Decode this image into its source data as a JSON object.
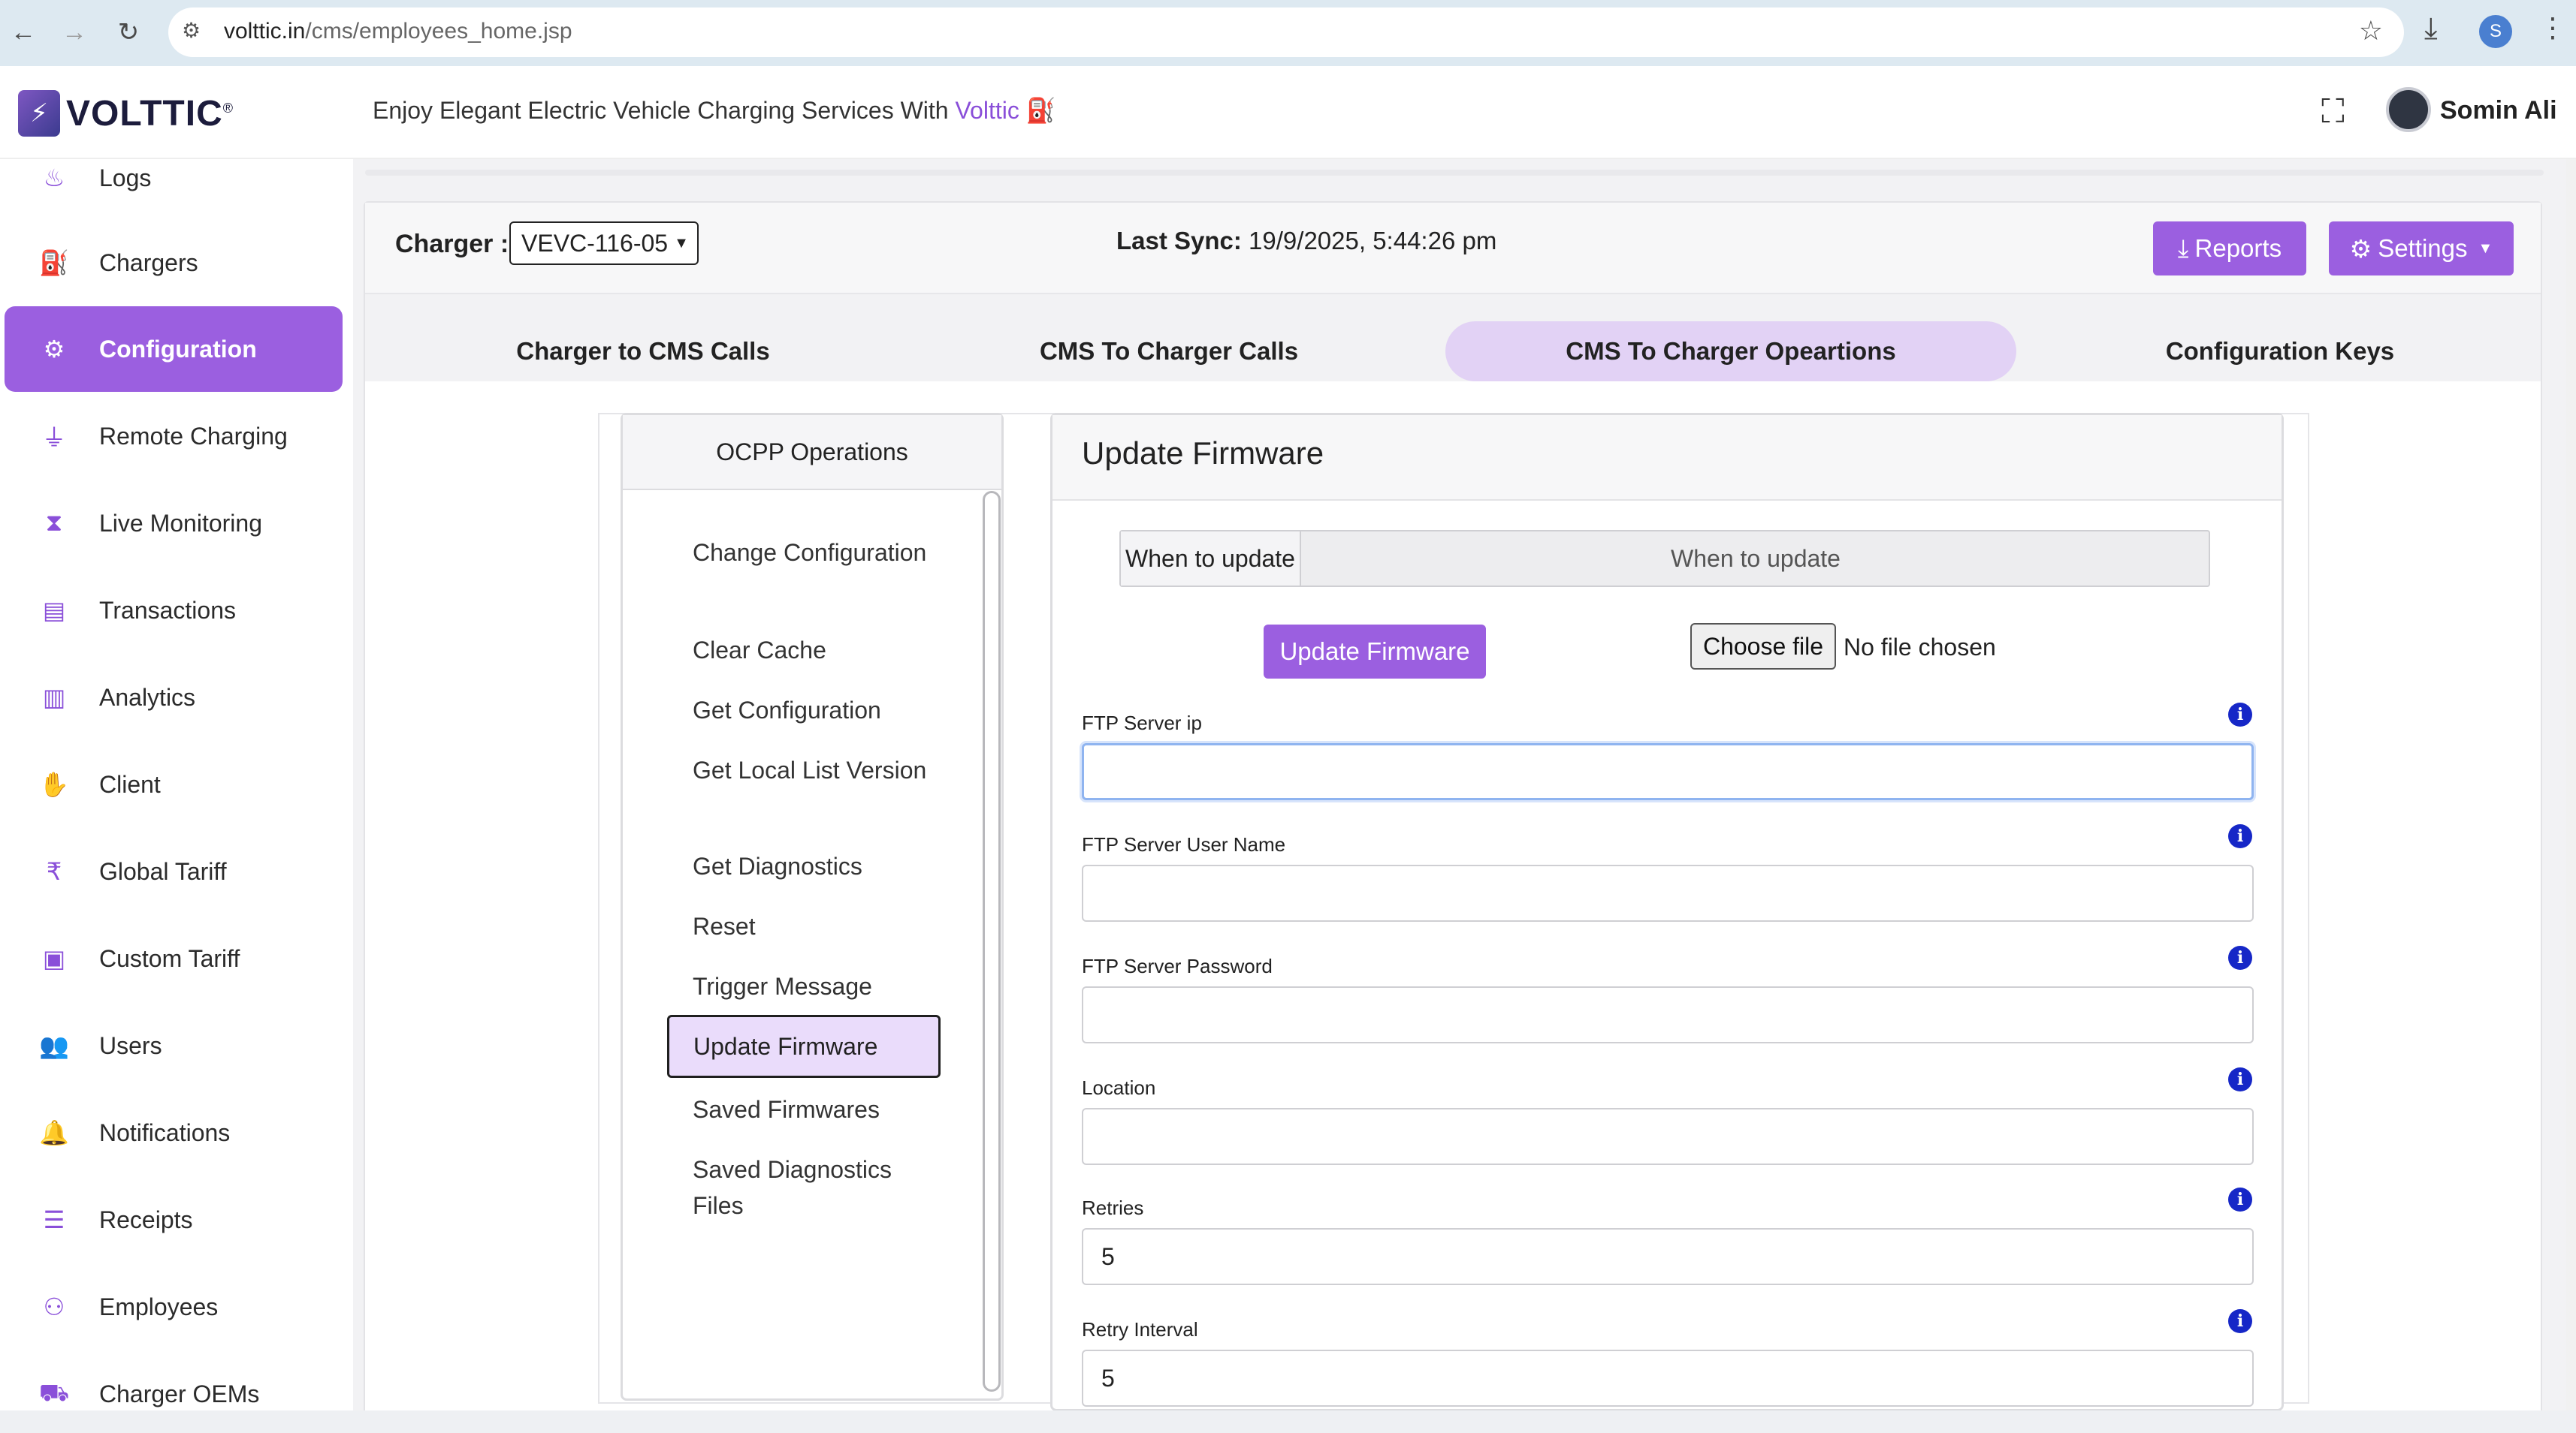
{
  "browser": {
    "url_domain": "volttic.in",
    "url_path": "/cms/employees_home.jsp"
  },
  "header": {
    "logo_text": "VOLTTIC",
    "tagline_prefix": "Enjoy Elegant Electric Vehicle Charging Services With ",
    "tagline_brand": "Volttic",
    "user_name": "Somin Ali",
    "profile_initial": "S"
  },
  "sidebar": {
    "items": [
      {
        "label": "Logs",
        "icon": "logs-icon"
      },
      {
        "label": "Chargers",
        "icon": "charger-icon"
      },
      {
        "label": "Configuration",
        "icon": "gears-icon",
        "active": true
      },
      {
        "label": "Remote Charging",
        "icon": "plug-icon"
      },
      {
        "label": "Live Monitoring",
        "icon": "hourglass-icon"
      },
      {
        "label": "Transactions",
        "icon": "card-icon"
      },
      {
        "label": "Analytics",
        "icon": "bar-chart-icon"
      },
      {
        "label": "Client",
        "icon": "handshake-icon"
      },
      {
        "label": "Global Tariff",
        "icon": "rupee-icon"
      },
      {
        "label": "Custom Tariff",
        "icon": "tariff-icon"
      },
      {
        "label": "Users",
        "icon": "users-icon"
      },
      {
        "label": "Notifications",
        "icon": "bell-icon"
      },
      {
        "label": "Receipts",
        "icon": "receipt-icon"
      },
      {
        "label": "Employees",
        "icon": "employees-icon"
      },
      {
        "label": "Charger OEMs",
        "icon": "oem-icon"
      }
    ]
  },
  "toolbar": {
    "charger_label": "Charger :",
    "charger_value": "VEVC-116-05",
    "sync_label": "Last Sync:",
    "sync_value": " 19/9/2025, 5:44:26 pm",
    "reports_label": "Reports",
    "settings_label": "Settings"
  },
  "tabs": [
    {
      "label": "Charger to CMS Calls"
    },
    {
      "label": "CMS To Charger Calls"
    },
    {
      "label": "CMS To Charger Opeartions",
      "active": true
    },
    {
      "label": "Configuration Keys"
    }
  ],
  "ops": {
    "title": "OCPP Operations",
    "items": [
      "Change Configuration",
      "Clear Cache",
      "Get Configuration",
      "Get Local List Version",
      "Get Diagnostics",
      "Reset",
      "Trigger Message",
      "Update Firmware",
      "Saved Firmwares",
      "Saved Diagnostics Files"
    ],
    "active_index": 7
  },
  "form": {
    "title": "Update Firmware",
    "when_label": "When to update",
    "when_placeholder": "When to update",
    "update_button": "Update Firmware",
    "choose_file": "Choose file",
    "no_file": "No file chosen",
    "fields": [
      {
        "label": "FTP Server ip",
        "value": ""
      },
      {
        "label": "FTP Server User Name",
        "value": ""
      },
      {
        "label": "FTP Server Password",
        "value": ""
      },
      {
        "label": "Location",
        "value": ""
      },
      {
        "label": "Retries",
        "value": "5"
      },
      {
        "label": "Retry Interval",
        "value": "5"
      }
    ]
  },
  "colors": {
    "accent": "#9b5fe0",
    "tab_active": "#e2d2f5",
    "info": "#1627c7"
  }
}
